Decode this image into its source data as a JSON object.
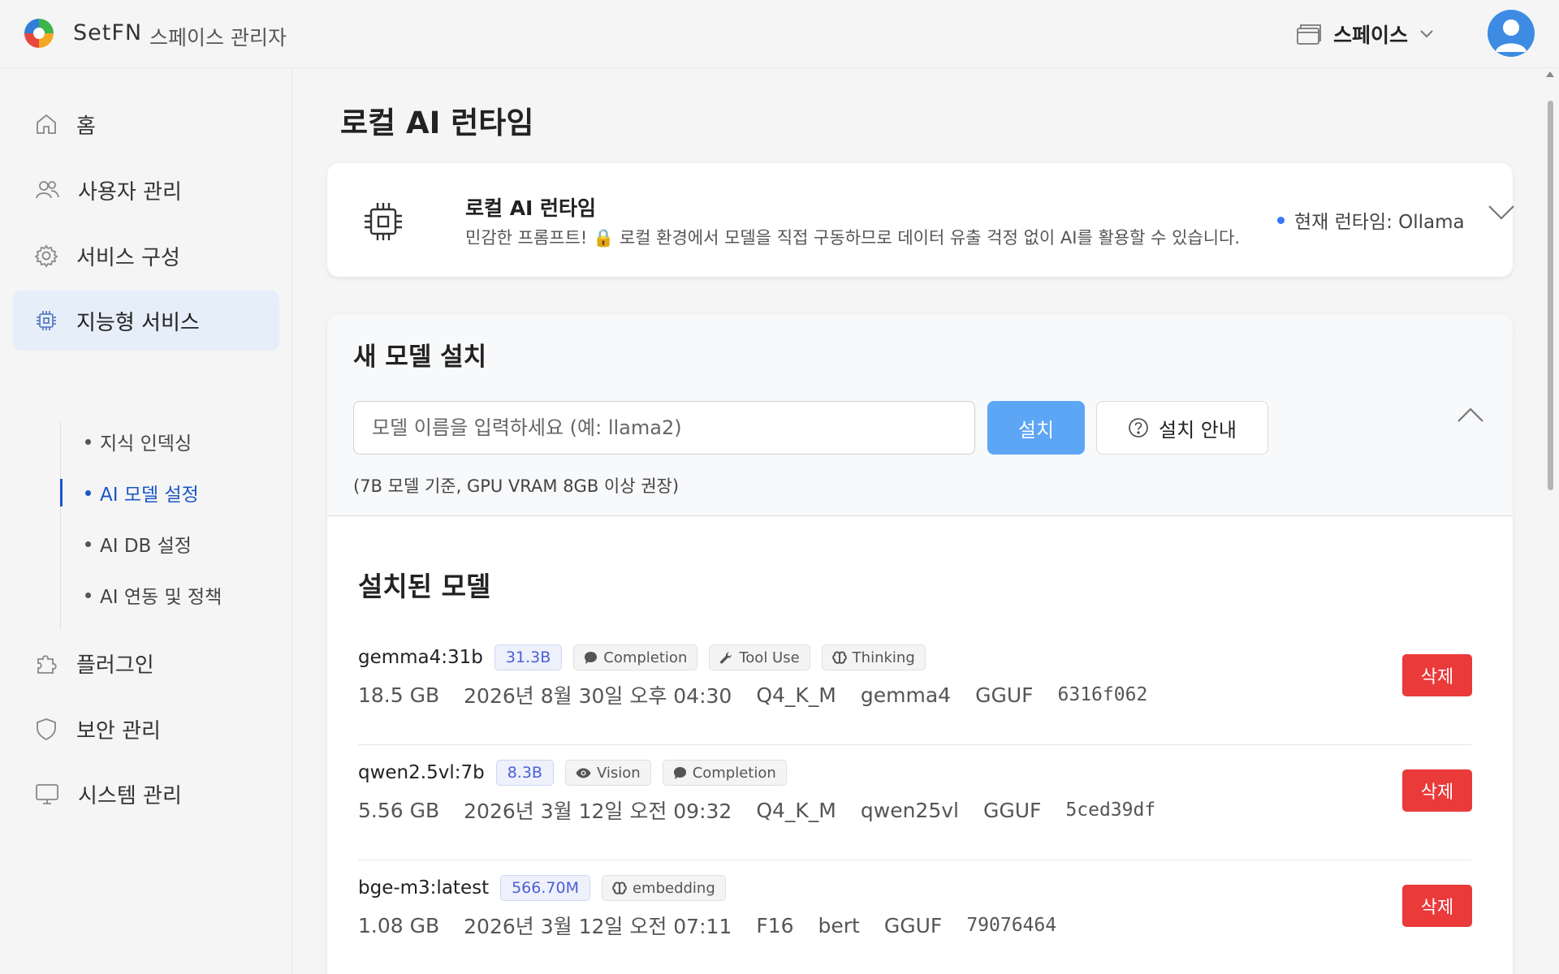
{
  "header": {
    "brand": "SetFN",
    "subtitle": "스페이스 관리자",
    "space_label": "스페이스",
    "icons": [
      "logo-icon",
      "window-icon",
      "chevron-down-icon",
      "user-avatar-icon"
    ]
  },
  "sidebar": {
    "items": [
      {
        "label": "홈",
        "icon": "home-icon"
      },
      {
        "label": "사용자 관리",
        "icon": "users-icon"
      },
      {
        "label": "서비스 구성",
        "icon": "gear-icon"
      },
      {
        "label": "지능형 서비스",
        "icon": "chip-icon",
        "active": true
      },
      {
        "label": "플러그인",
        "icon": "puzzle-icon"
      },
      {
        "label": "보안 관리",
        "icon": "shield-icon"
      },
      {
        "label": "시스템 관리",
        "icon": "monitor-icon"
      }
    ],
    "sub_items": [
      {
        "label": "지식 인덱싱"
      },
      {
        "label": "AI 모델 설정",
        "active": true
      },
      {
        "label": "AI DB 설정"
      },
      {
        "label": "AI 연동 및 정책"
      }
    ]
  },
  "main": {
    "page_title": "로컬 AI 런타임",
    "runtime": {
      "title": "로컬 AI 런타임",
      "description": "민감한 프롬프트! 🔒 로컬 환경에서 모델을 직접 구동하므로 데이터 유출 걱정 없이 AI를 활용할 수 있습니다.",
      "status": "현재 런타임: Ollama"
    },
    "install": {
      "title": "새 모델 설치",
      "input_placeholder": "모델 이름을 입력하세요 (예: llama2)",
      "install_button": "설치",
      "guide_button": "설치 안내",
      "hint": "(7B 모델 기준, GPU VRAM 8GB 이상 권장)"
    },
    "installed_title": "설치된 모델",
    "models": [
      {
        "name": "gemma4:31b",
        "params": "31.3B",
        "capabilities": [
          {
            "label": "Completion",
            "icon": "chat-icon"
          },
          {
            "label": "Tool Use",
            "icon": "wrench-icon"
          },
          {
            "label": "Thinking",
            "icon": "brain-icon"
          }
        ],
        "size": "18.5 GB",
        "date": "2026년 8월 30일 오후 04:30",
        "quant": "Q4_K_M",
        "family": "gemma4",
        "format": "GGUF",
        "digest": "6316f062",
        "delete_label": "삭제"
      },
      {
        "name": "qwen2.5vl:7b",
        "params": "8.3B",
        "capabilities": [
          {
            "label": "Vision",
            "icon": "eye-icon"
          },
          {
            "label": "Completion",
            "icon": "chat-icon"
          }
        ],
        "size": "5.56 GB",
        "date": "2026년 3월 12일 오전 09:32",
        "quant": "Q4_K_M",
        "family": "qwen25vl",
        "format": "GGUF",
        "digest": "5ced39df",
        "delete_label": "삭제"
      },
      {
        "name": "bge-m3:latest",
        "params": "566.70M",
        "capabilities": [
          {
            "label": "embedding",
            "icon": "brain-icon"
          }
        ],
        "size": "1.08 GB",
        "date": "2026년 3월 12일 오전 07:11",
        "quant": "F16",
        "family": "bert",
        "format": "GGUF",
        "digest": "79076464",
        "delete_label": "삭제"
      }
    ]
  },
  "colors": {
    "accent": "#1a56c8",
    "install_button": "#5ca6f5",
    "delete_button": "#ea3a3a",
    "active_nav_bg": "#e6eef9",
    "status_dot": "#3478f6"
  }
}
